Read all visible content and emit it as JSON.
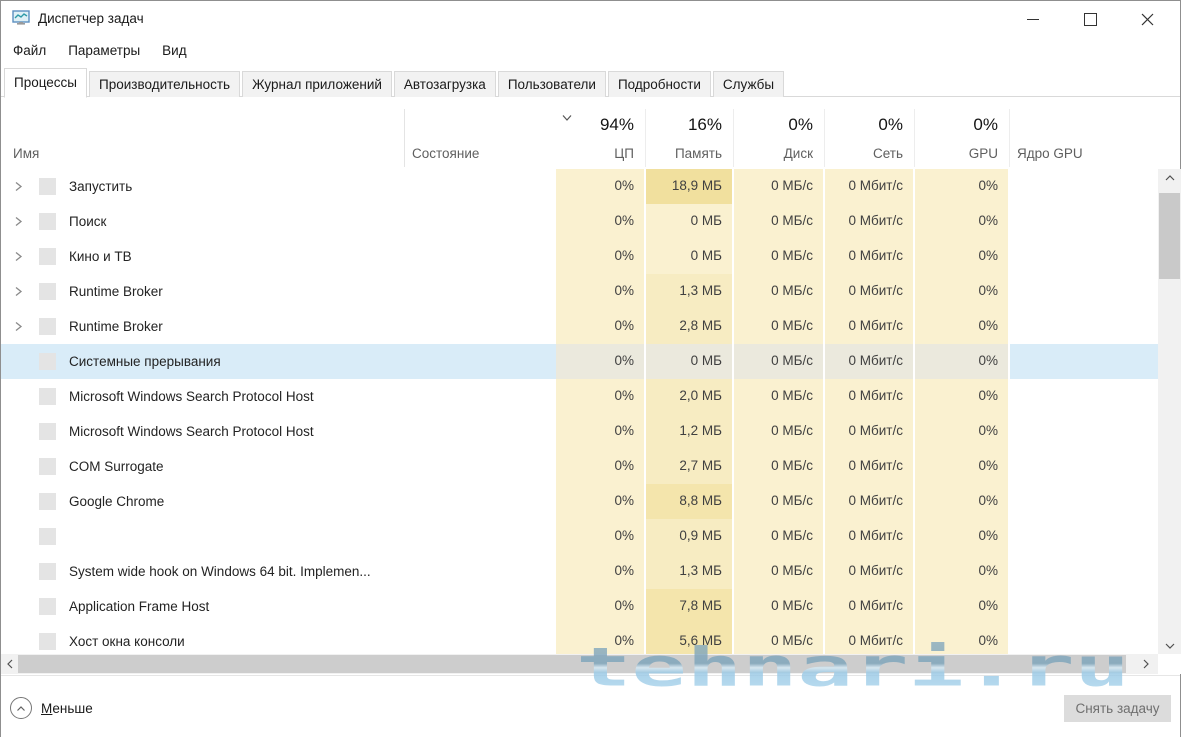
{
  "window": {
    "title": "Диспетчер задач"
  },
  "menu": {
    "items": [
      "Файл",
      "Параметры",
      "Вид"
    ]
  },
  "tabs": [
    {
      "label": "Процессы",
      "active": true
    },
    {
      "label": "Производительность"
    },
    {
      "label": "Журнал приложений"
    },
    {
      "label": "Автозагрузка"
    },
    {
      "label": "Пользователи"
    },
    {
      "label": "Подробности"
    },
    {
      "label": "Службы"
    }
  ],
  "header": {
    "name_label": "Имя",
    "status_label": "Состояние",
    "gpu_engine_label": "Ядро GPU"
  },
  "header_columns": [
    {
      "key": "cpu",
      "percent": "94%",
      "label": "ЦП",
      "sorted": true
    },
    {
      "key": "mem",
      "percent": "16%",
      "label": "Память"
    },
    {
      "key": "disk",
      "percent": "0%",
      "label": "Диск"
    },
    {
      "key": "net",
      "percent": "0%",
      "label": "Сеть"
    },
    {
      "key": "gpu",
      "percent": "0%",
      "label": "GPU"
    }
  ],
  "table": {
    "rows": [
      {
        "name": "Запустить",
        "has_chevron": true,
        "mem_level": 3,
        "cpu": "0%",
        "memory": "18,9 МБ",
        "disk": "0 МБ/с",
        "network": "0 Мбит/с",
        "gpu": "0%"
      },
      {
        "name": "Поиск",
        "has_chevron": true,
        "mem_level": 0,
        "cpu": "0%",
        "memory": "0 МБ",
        "disk": "0 МБ/с",
        "network": "0 Мбит/с",
        "gpu": "0%"
      },
      {
        "name": "Кино и ТВ",
        "has_chevron": true,
        "mem_level": 0,
        "cpu": "0%",
        "memory": "0 МБ",
        "disk": "0 МБ/с",
        "network": "0 Мбит/с",
        "gpu": "0%"
      },
      {
        "name": "Runtime Broker",
        "has_chevron": true,
        "mem_level": 1,
        "cpu": "0%",
        "memory": "1,3 МБ",
        "disk": "0 МБ/с",
        "network": "0 Мбит/с",
        "gpu": "0%"
      },
      {
        "name": "Runtime Broker",
        "has_chevron": true,
        "mem_level": 1,
        "cpu": "0%",
        "memory": "2,8 МБ",
        "disk": "0 МБ/с",
        "network": "0 Мбит/с",
        "gpu": "0%"
      },
      {
        "name": "Системные прерывания",
        "has_chevron": false,
        "selected": true,
        "mem_level": 0,
        "cpu": "0%",
        "memory": "0 МБ",
        "disk": "0 МБ/с",
        "network": "0 Мбит/с",
        "gpu": "0%"
      },
      {
        "name": "Microsoft Windows Search Protocol Host",
        "has_chevron": false,
        "mem_level": 1,
        "cpu": "0%",
        "memory": "2,0 МБ",
        "disk": "0 МБ/с",
        "network": "0 Мбит/с",
        "gpu": "0%"
      },
      {
        "name": "Microsoft Windows Search Protocol Host",
        "has_chevron": false,
        "mem_level": 1,
        "cpu": "0%",
        "memory": "1,2 МБ",
        "disk": "0 МБ/с",
        "network": "0 Мбит/с",
        "gpu": "0%"
      },
      {
        "name": "COM Surrogate",
        "has_chevron": false,
        "mem_level": 1,
        "cpu": "0%",
        "memory": "2,7 МБ",
        "disk": "0 МБ/с",
        "network": "0 Мбит/с",
        "gpu": "0%"
      },
      {
        "name": "Google Chrome",
        "has_chevron": false,
        "mem_level": 2,
        "cpu": "0%",
        "memory": "8,8 МБ",
        "disk": "0 МБ/с",
        "network": "0 Мбит/с",
        "gpu": "0%"
      },
      {
        "name": "",
        "has_chevron": false,
        "mem_level": 1,
        "cpu": "0%",
        "memory": "0,9 МБ",
        "disk": "0 МБ/с",
        "network": "0 Мбит/с",
        "gpu": "0%"
      },
      {
        "name": "System wide hook on Windows 64 bit. Implemen...",
        "has_chevron": false,
        "mem_level": 1,
        "cpu": "0%",
        "memory": "1,3 МБ",
        "disk": "0 МБ/с",
        "network": "0 Мбит/с",
        "gpu": "0%"
      },
      {
        "name": "Application Frame Host",
        "has_chevron": false,
        "mem_level": 2,
        "cpu": "0%",
        "memory": "7,8 МБ",
        "disk": "0 МБ/с",
        "network": "0 Мбит/с",
        "gpu": "0%"
      },
      {
        "name": "Хост окна консоли",
        "has_chevron": false,
        "mem_level": 2,
        "cpu": "0%",
        "memory": "5,6 МБ",
        "disk": "0 МБ/с",
        "network": "0 Мбит/с",
        "gpu": "0%"
      }
    ]
  },
  "footer": {
    "fewer_label": "Меньше",
    "end_task_label": "Снять задачу"
  },
  "watermark": {
    "text": "tehnari.ru"
  },
  "icons": {
    "app": "task-manager-monitor-chart",
    "sort_indicator": "chevron-down",
    "row_expand": "chevron-right",
    "fewer": "chevron-up-in-circle",
    "minimize": "dash",
    "maximize": "square-outline",
    "close": "x"
  },
  "colors": {
    "heat_base": "#faf1d0",
    "heat_mem_low": "#f7ecc2",
    "heat_mem_mid": "#f4e5ac",
    "heat_mem_high": "#f1e09e",
    "selection_blue": "#d9ecf8",
    "selected_heat": "#ebe9dd",
    "watermark_blue": "#8fc3e4"
  }
}
